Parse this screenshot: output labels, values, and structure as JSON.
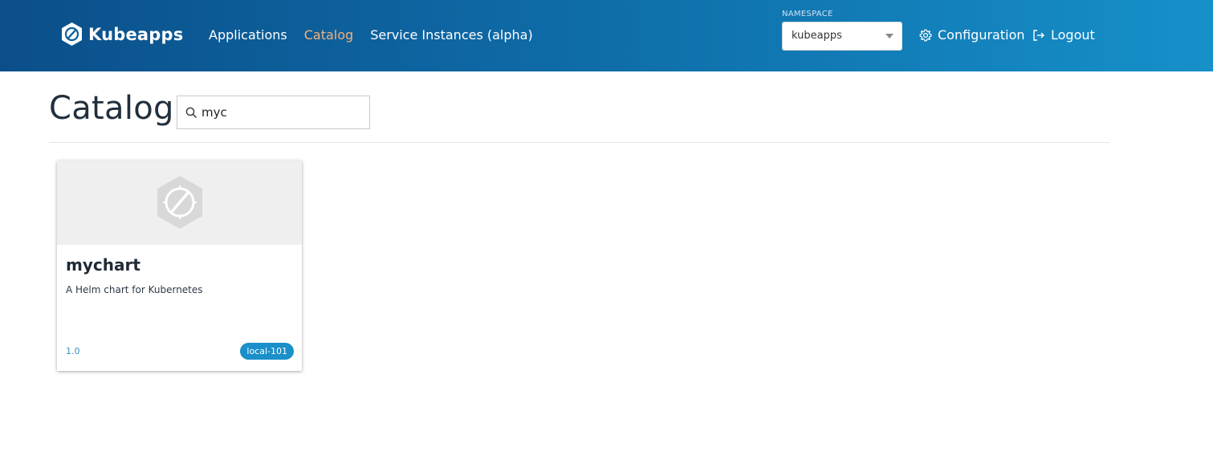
{
  "header": {
    "brand": "Kubeapps",
    "nav": [
      {
        "label": "Applications",
        "active": false
      },
      {
        "label": "Catalog",
        "active": true
      },
      {
        "label": "Service Instances (alpha)",
        "active": false
      }
    ],
    "namespace_label": "NAMESPACE",
    "namespace_value": "kubeapps",
    "configuration_label": "Configuration",
    "logout_label": "Logout",
    "colors": {
      "gradient_start": "#0b4f8a",
      "gradient_end": "#1690c9",
      "active_nav": "#f6b07a"
    },
    "icons": [
      "kubeapps-logo-icon",
      "gear-icon",
      "logout-icon"
    ]
  },
  "main": {
    "title": "Catalog",
    "search": {
      "value": "myc",
      "icon": "search-icon"
    }
  },
  "charts": [
    {
      "name": "mychart",
      "description": "A Helm chart for Kubernetes",
      "version": "1.0",
      "repo": "local-101",
      "icon": "placeholder-chart-icon",
      "badge_color": "#1a8fc9"
    }
  ]
}
